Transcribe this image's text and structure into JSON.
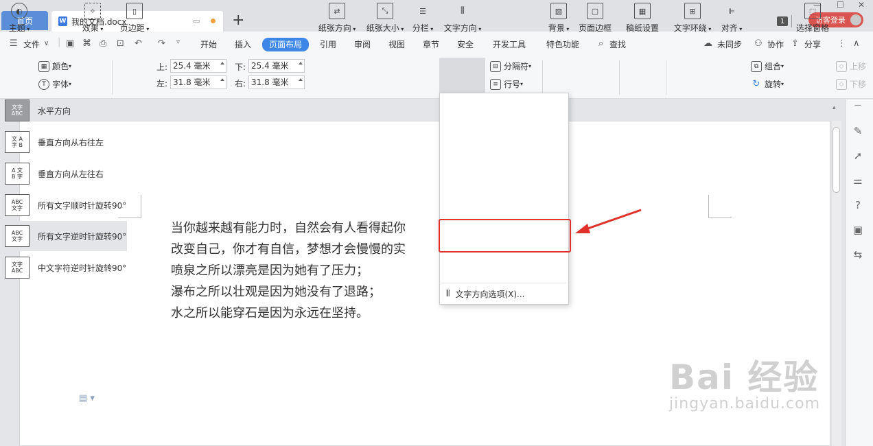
{
  "tabs": {
    "home": "首页",
    "doc_title": "我的文档.docx",
    "add": "+",
    "badge": "1",
    "login": "访客登录"
  },
  "menu": {
    "file": "文件",
    "items": [
      "开始",
      "插入",
      "页面布局",
      "引用",
      "审阅",
      "视图",
      "章节",
      "安全",
      "开发工具",
      "特色功能",
      "查找"
    ],
    "active": "页面布局",
    "sync": "未同步",
    "collab": "协作",
    "share": "分享"
  },
  "ribbon": {
    "theme": "主题",
    "color": "颜色",
    "font": "字体",
    "effect": "效果",
    "margins": "页边距",
    "top_label": "上:",
    "top_value": "25.4 毫米",
    "bottom_label": "下:",
    "bottom_value": "25.4 毫米",
    "left_label": "左:",
    "left_value": "31.8 毫米",
    "right_label": "右:",
    "right_value": "31.8 毫米",
    "orientation": "纸张方向",
    "size": "纸张大小",
    "columns": "分栏",
    "text_direction": "文字方向",
    "separator": "分隔符",
    "line_number": "行号",
    "background": "背景",
    "page_border": "页面边框",
    "draft_paper": "稿纸设置",
    "text_wrap": "文字环绕",
    "align": "对齐",
    "group": "组合",
    "rotate": "旋转",
    "selection_pane": "选择窗格",
    "up": "上移",
    "down": "下移"
  },
  "document": {
    "lines": [
      "当你越来越有能力时，自然会有人看得起你",
      "改变自己，你才有自信，梦想才会慢慢的实",
      "喷泉之所以漂亮是因为她有了压力；",
      "瀑布之所以壮观是因为她没有了退路；",
      "水之所以能穿石是因为永远在坚持。"
    ]
  },
  "dropdown": {
    "items": [
      {
        "label": "水平方向",
        "icon": "文字\nABC"
      },
      {
        "label": "垂直方向从右往左",
        "icon": "文 A\n字 B"
      },
      {
        "label": "垂直方向从左往右",
        "icon": "A 文\nB 字"
      },
      {
        "label": "所有文字顺时针旋转90°",
        "icon": "ABC\n文字"
      },
      {
        "label": "所有文字逆时针旋转90°",
        "icon": "ABC\n文字"
      },
      {
        "label": "中文字符逆时针旋转90°",
        "icon": "文字\nABC"
      }
    ],
    "options": "文字方向选项(X)..."
  },
  "watermark": {
    "main": "Bai 经验",
    "sub": "jingyan.baidu.com"
  },
  "colors": {
    "accent": "#3c87e8",
    "login": "#d9534f",
    "highlight": "#e0302a"
  }
}
